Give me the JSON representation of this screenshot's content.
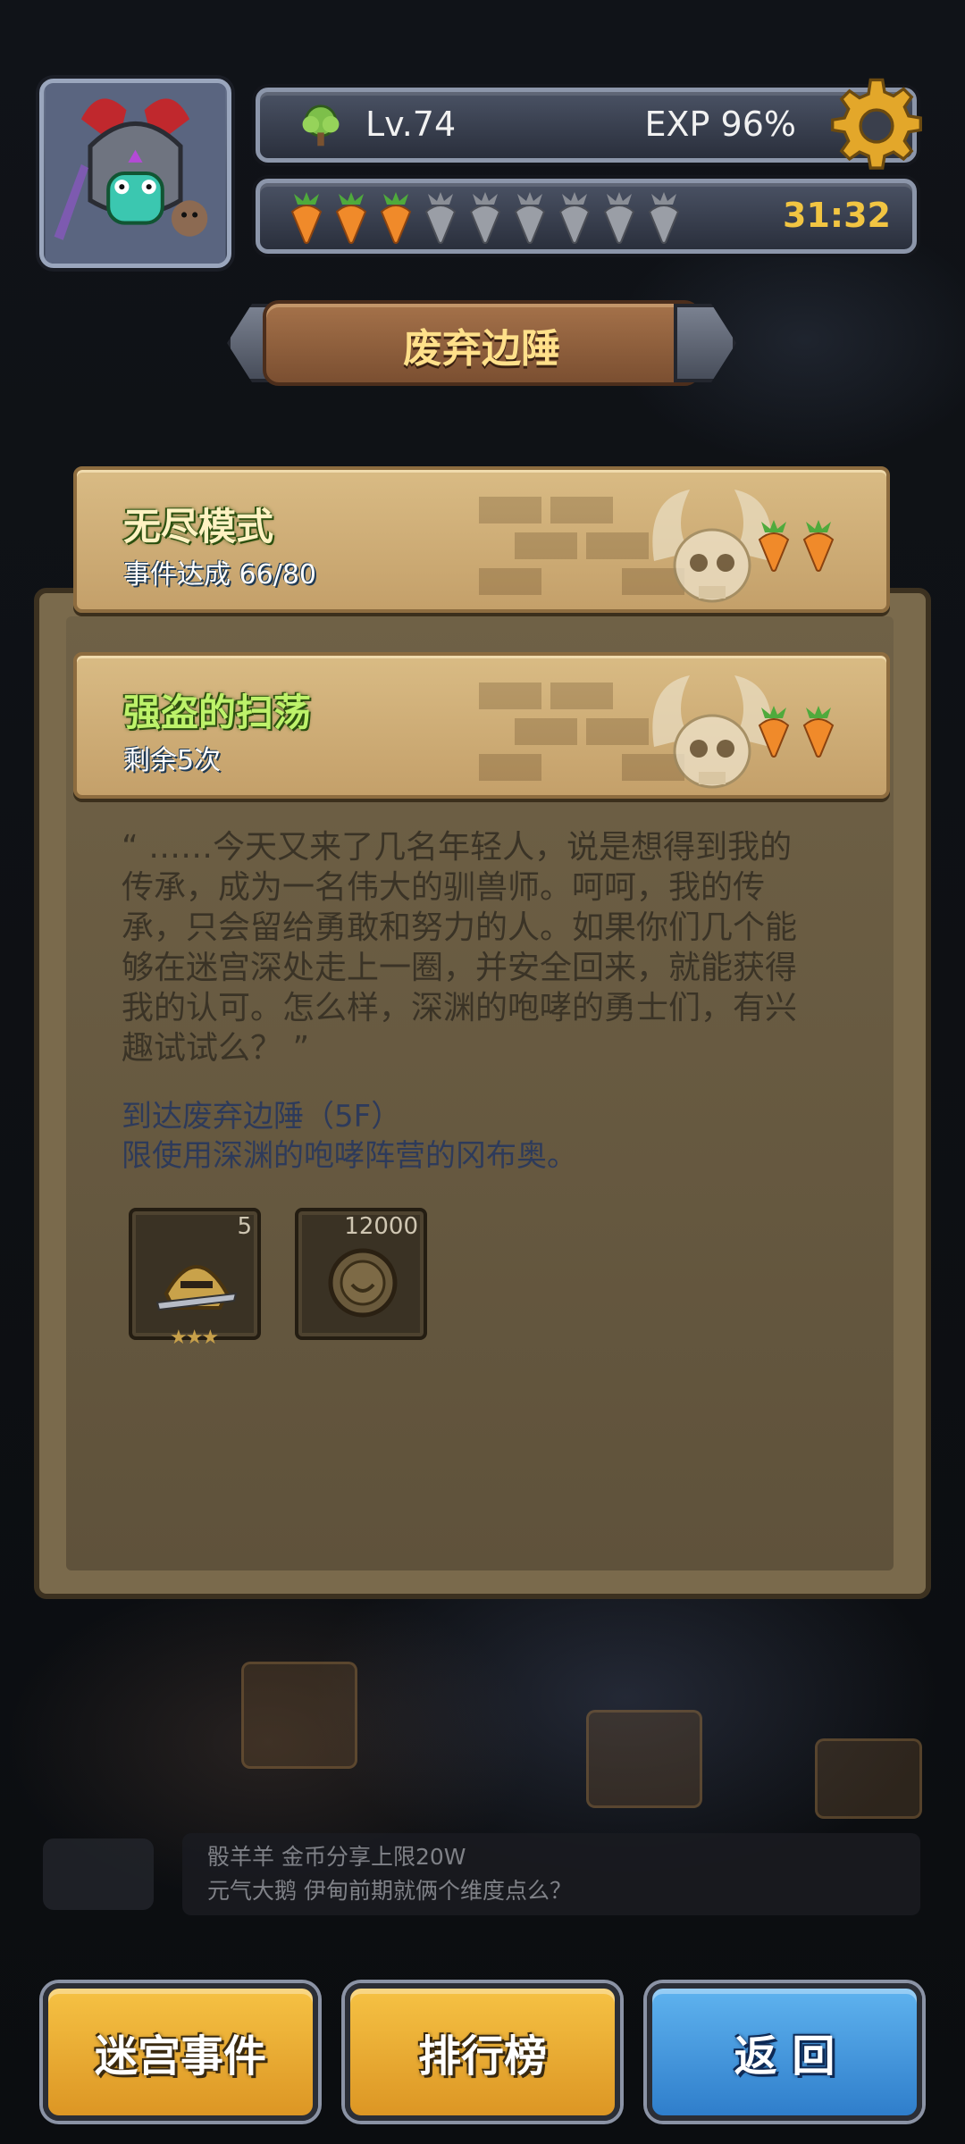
{
  "hud": {
    "level": "Lv.74",
    "exp": "EXP  96%",
    "carrots_full": 3,
    "carrots_total": 9,
    "timer": "31:32"
  },
  "title": "废弃边陲",
  "modes": [
    {
      "title": "无尽模式",
      "subtitle": "事件达成  66/80"
    },
    {
      "title": "强盗的扫荡",
      "subtitle": "剩余5次"
    }
  ],
  "story": "“ ……今天又来了几名年轻人，说是想得到我的传承，成为一名伟大的驯兽师。呵呵，我的传承，只会留给勇敢和努力的人。如果你们几个能够在迷宫深处走上一圈，并安全回来，就能获得我的认可。怎么样，深渊的咆哮的勇士们，有兴趣试试么？ ”",
  "mission": {
    "line1": "到达废弃边陲（5F）",
    "line2": "限使用深渊的咆哮阵营的冈布奥。"
  },
  "rewards": [
    {
      "icon": "knight-helmet-icon",
      "qty": "5"
    },
    {
      "icon": "coin-icon",
      "qty": "12000"
    }
  ],
  "chat": {
    "line1": "骰羊羊  金币分享上限20W",
    "line2": "元气大鹅  伊甸前期就俩个维度点么？"
  },
  "buttons": {
    "maze_event": "迷宫事件",
    "leaderboard": "排行榜",
    "back": "返 回"
  },
  "colors": {
    "gold_button": "#f6c244",
    "blue_button": "#5fb3ef",
    "timer": "#f2c542",
    "green_title": "#bdf26a"
  }
}
